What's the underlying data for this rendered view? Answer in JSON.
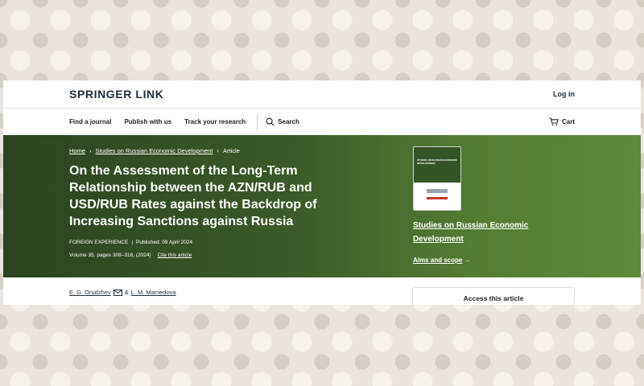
{
  "header": {
    "logo": "SPRINGER LINK",
    "login": "Log in"
  },
  "nav": {
    "items": [
      "Find a journal",
      "Publish with us",
      "Track your research"
    ],
    "search": "Search",
    "cart": "Cart"
  },
  "breadcrumb": {
    "items": [
      "Home",
      "Studies on Russian Economic Development",
      "Article"
    ],
    "separator": "›"
  },
  "article": {
    "title": "On the Assessment of the Long-Term Relationship between the AZN/RUB and USD/RUB Rates against the Backdrop of Increasing Sanctions against Russia",
    "section": "FOREIGN EXPERIENCE",
    "published": "Published: 09 April 2024",
    "meta_separator": "|",
    "volume": "Volume 35, pages 308–318, (2024)",
    "cite": "Cite this article"
  },
  "journal": {
    "name": "Studies on Russian Economic Development",
    "aims": "Aims and scope",
    "aims_arrow": "→",
    "cover_text": "STUDIES ON RUSSIAN ECONOMIC DEVELOPMENT"
  },
  "authors": {
    "first": "E. G. Orudzhev",
    "joiner": "&",
    "second": "L. M. Mamedova"
  },
  "access": {
    "label": "Access this article"
  },
  "colors": {
    "hero_start": "#2b4420",
    "hero_end": "#5f8a3a",
    "text_dark": "#1f2b3c"
  }
}
